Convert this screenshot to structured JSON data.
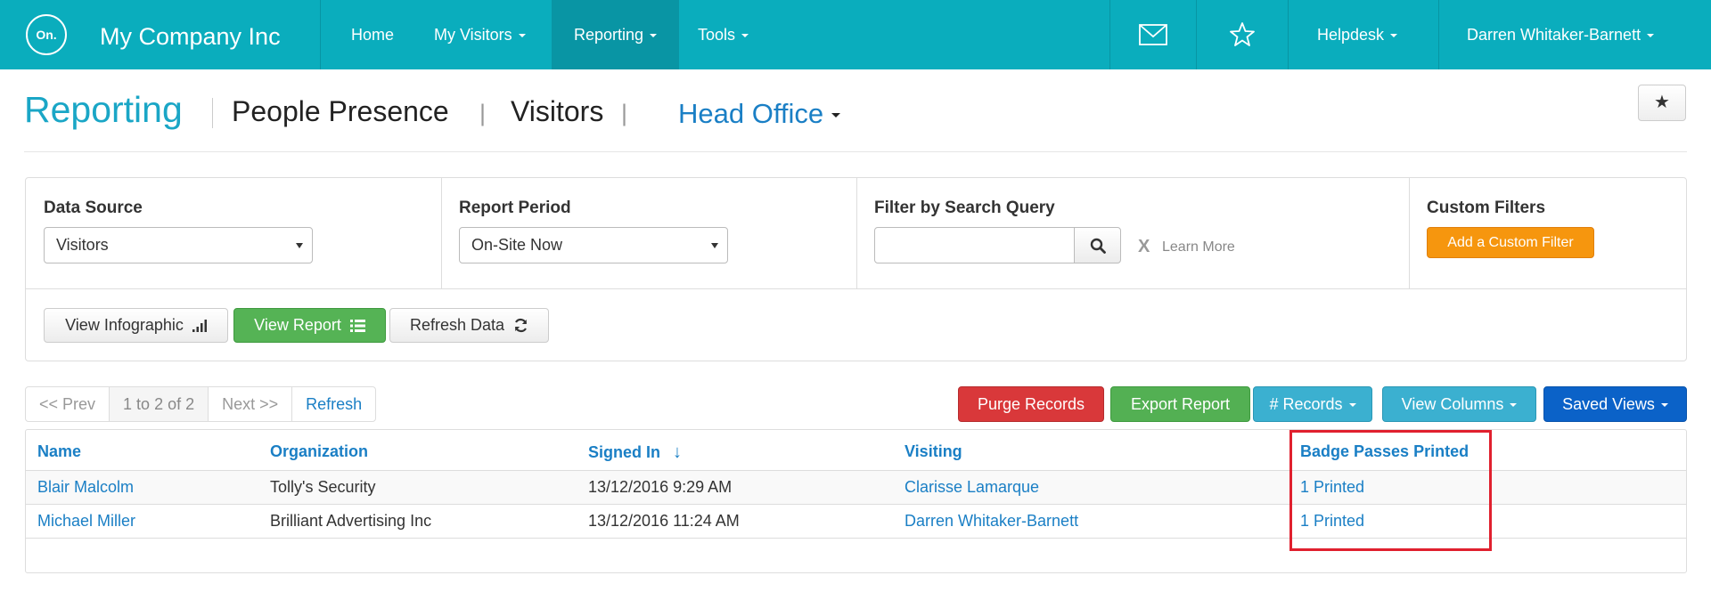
{
  "app": {
    "logo_text": "On.",
    "brand": "My Company Inc"
  },
  "nav": {
    "home": "Home",
    "my_visitors": "My Visitors",
    "reporting": "Reporting",
    "tools": "Tools",
    "mail_icon": "envelope-icon",
    "favorite_icon": "star-icon",
    "helpdesk": "Helpdesk",
    "user": "Darren Whitaker-Barnett"
  },
  "header": {
    "title": "Reporting",
    "crumb_people": "People Presence",
    "crumb_visitors": "Visitors",
    "pipe": "|",
    "location": "Head Office",
    "favorite_button": "★"
  },
  "filters": {
    "data_source_label": "Data Source",
    "data_source_value": "Visitors",
    "report_period_label": "Report Period",
    "report_period_value": "On-Site Now",
    "search_label": "Filter by Search Query",
    "search_value": "",
    "learn_x": "X",
    "learn_more": "Learn More",
    "custom_label": "Custom Filters",
    "add_custom": "Add a Custom Filter"
  },
  "actions": {
    "view_infographic": "View Infographic",
    "view_report": "View Report",
    "refresh_data": "Refresh Data"
  },
  "pager": {
    "prev": "<< Prev",
    "range": "1 to 2 of 2",
    "next": "Next >>",
    "refresh": "Refresh"
  },
  "toolbar": {
    "purge": "Purge Records",
    "export": "Export Report",
    "records": "# Records",
    "view_columns": "View Columns",
    "saved_views": "Saved Views"
  },
  "table": {
    "columns": [
      "Name",
      "Organization",
      "Signed In",
      "Visiting",
      "Badge Passes Printed"
    ],
    "sort_indicator": "↓",
    "rows": [
      {
        "name": "Blair Malcolm",
        "organization": "Tolly's Security",
        "signed_in": "13/12/2016 9:29 AM",
        "visiting": "Clarisse Lamarque",
        "badges": "1 Printed"
      },
      {
        "name": "Michael Miller",
        "organization": "Brilliant Advertising Inc",
        "signed_in": "13/12/2016 11:24 AM",
        "visiting": "Darren Whitaker-Barnett",
        "badges": "1 Printed"
      }
    ]
  },
  "colors": {
    "nav_bg": "#0aadbd",
    "link": "#1a7fc5",
    "highlight": "#e0202e"
  }
}
